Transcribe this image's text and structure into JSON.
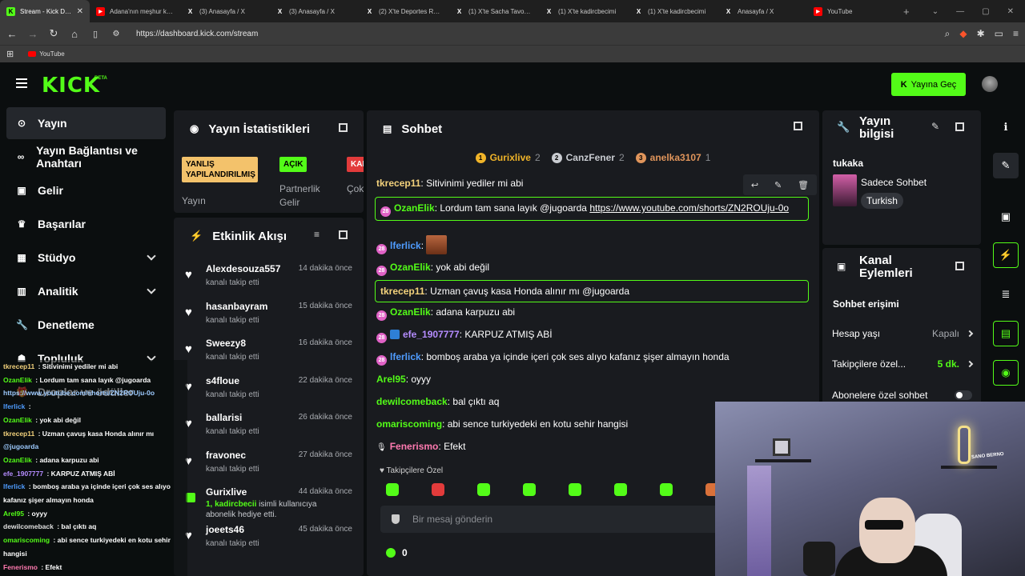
{
  "browser": {
    "tabs": [
      {
        "title": "Stream - Kick Dashboard",
        "icon": "kick-icon",
        "active": true
      },
      {
        "title": "Adana'nın meşhur karpuzu",
        "icon": "youtube-icon"
      },
      {
        "title": "(3) Anasayfa / X",
        "icon": "x-icon"
      },
      {
        "title": "(3) Anasayfa / X",
        "icon": "x-icon"
      },
      {
        "title": "(2) X'te Deportes Report",
        "icon": "x-icon"
      },
      {
        "title": "(1) X'te Sacha Tavolieri",
        "icon": "x-icon"
      },
      {
        "title": "(1) X'te kadircbecimi",
        "icon": "x-icon"
      },
      {
        "title": "(1) X'te kadircbecimi",
        "icon": "x-icon"
      },
      {
        "title": "Anasayfa / X",
        "icon": "x-icon"
      },
      {
        "title": "YouTube",
        "icon": "youtube-icon"
      }
    ],
    "new_tab": "+",
    "url": "https://dashboard.kick.com/stream",
    "bookmark": "YouTube"
  },
  "header": {
    "logo": "KICK",
    "beta": "BETA",
    "go_live": "Yayına Geç"
  },
  "sidebar": {
    "items": [
      {
        "label": "Yayın",
        "icon": "play-circle-icon",
        "active": true
      },
      {
        "label": "Yayın Bağlantısı ve Anahtarı",
        "icon": "link-icon"
      },
      {
        "label": "Gelir",
        "icon": "wallet-icon"
      },
      {
        "label": "Başarılar",
        "icon": "trophy-icon"
      },
      {
        "label": "Stüdyo",
        "icon": "studio-icon",
        "chevron": true
      },
      {
        "label": "Analitik",
        "icon": "chart-icon",
        "chevron": true
      },
      {
        "label": "Denetleme",
        "icon": "wrench-icon"
      },
      {
        "label": "Topluluk",
        "icon": "community-icon",
        "chevron": true
      },
      {
        "label": "Droplar ve ödüller",
        "icon": "gift-icon"
      }
    ]
  },
  "overlay_chat": [
    {
      "user": "tkrecep11",
      "text": " : Sitivinimi yediler mi abi",
      "color": "#f3d27c"
    },
    {
      "user": "OzanElik",
      "text": " : Lordum tam sana layık @jugoarda",
      "color": "#53fc18"
    },
    {
      "user": "",
      "text": "https://www.youtube.com/shorts/ZN2ROUju-0o",
      "color": "#9ecbff"
    },
    {
      "user": "lferlick",
      "text": " : ",
      "color": "#4f9cff"
    },
    {
      "user": "OzanElik",
      "text": " : yok abi değil",
      "color": "#53fc18"
    },
    {
      "user": "tkrecep11",
      "text": " : Uzman çavuş kasa Honda alınır mı",
      "color": "#f3d27c"
    },
    {
      "user": "",
      "text": "@jugoarda",
      "color": "#9ecbff"
    },
    {
      "user": "OzanElik",
      "text": " : adana karpuzu abi",
      "color": "#53fc18"
    },
    {
      "user": "efe_1907777",
      "text": " : KARPUZ ATMIŞ ABİ",
      "color": "#b58cff"
    },
    {
      "user": "lferlick",
      "text": " : bomboş araba ya içinde içeri çok ses alıyo",
      "color": "#4f9cff"
    },
    {
      "user": "",
      "text": "kafanız şişer almayın honda",
      "color": "#fff"
    },
    {
      "user": "Arel95",
      "text": " : oyyy",
      "color": "#53fc18"
    },
    {
      "user": "dewilcomeback",
      "text": " : bal çıktı aq",
      "color": "#e0e0e0"
    },
    {
      "user": "omariscoming",
      "text": " : abi sence turkiyedeki en kotu sehir",
      "color": "#53fc18"
    },
    {
      "user": "",
      "text": "hangisi",
      "color": "#fff"
    },
    {
      "user": "Fenerismo",
      "text": " : Efekt",
      "color": "#ff7ab0"
    }
  ],
  "stats": {
    "title": "Yayın İstatistikleri",
    "badges": [
      {
        "text": "YANLIŞ YAPILANDIRILMIŞ",
        "label": "Yayın",
        "bg": "#f3c26b"
      },
      {
        "text": "AÇIK",
        "label": "Partnerlik Gelir",
        "bg": "#53fc18"
      },
      {
        "text": "KAPALI",
        "label": "Çok Yayın",
        "bg": "#e23b3b"
      }
    ]
  },
  "activity": {
    "title": "Etkinlik Akışı",
    "items": [
      {
        "name": "Alexdesouza557",
        "time": "14 dakika önce",
        "desc": "kanalı takip etti",
        "type": "follow"
      },
      {
        "name": "hasanbayram",
        "time": "15 dakika önce",
        "desc": "kanalı takip etti",
        "type": "follow"
      },
      {
        "name": "Sweezy8",
        "time": "16 dakika önce",
        "desc": "kanalı takip etti",
        "type": "follow"
      },
      {
        "name": "s4floue",
        "time": "22 dakika önce",
        "desc": "kanalı takip etti",
        "type": "follow"
      },
      {
        "name": "ballarisi",
        "time": "26 dakika önce",
        "desc": "kanalı takip etti",
        "type": "follow"
      },
      {
        "name": "fravonec",
        "time": "27 dakika önce",
        "desc": "kanalı takip etti",
        "type": "follow"
      },
      {
        "name": "Gurixlive",
        "time": "44 dakika önce",
        "desc_count": "1,",
        "desc_user": "kadircbecii",
        "desc": "isimli kullanıcıya abonelik hediye etti.",
        "type": "gift"
      },
      {
        "name": "joeets46",
        "time": "45 dakika önce",
        "desc": "kanalı takip etti",
        "type": "follow"
      }
    ]
  },
  "chat": {
    "title": "Sohbet",
    "leaderboard": [
      {
        "rank": "1",
        "name": "Gurixlive",
        "count": "2",
        "color": "#f0b429"
      },
      {
        "rank": "2",
        "name": "CanzFener",
        "count": "2",
        "color": "#c9ccd1"
      },
      {
        "rank": "3",
        "name": "anelka3107",
        "count": "1",
        "color": "#e0955b"
      }
    ],
    "messages": [
      {
        "user": "tkrecep11",
        "text": "Sitivinimi yediler mi abi",
        "color": "#f3d27c"
      },
      {
        "user": "OzanElik",
        "text": "Lordum tam sana layık @jugoarda ",
        "link": "https://www.youtube.com/shorts/ZN2ROUju-0o",
        "color": "#53fc18"
      },
      {
        "user": "lferlick",
        "text": "",
        "color": "#4f9cff"
      },
      {
        "user": "OzanElik",
        "text": "yok abi değil",
        "color": "#53fc18"
      },
      {
        "user": "tkrecep11",
        "text": "Uzman çavuş kasa Honda alınır mı @jugoarda",
        "color": "#f3d27c"
      },
      {
        "user": "OzanElik",
        "text": "adana karpuzu abi",
        "color": "#53fc18"
      },
      {
        "user": "efe_1907777",
        "text": "KARPUZ ATMIŞ ABİ",
        "color": "#b58cff"
      },
      {
        "user": "lferlick",
        "text": "bomboş araba ya içinde içeri çok ses alıyo kafanız şişer almayın honda",
        "color": "#4f9cff"
      },
      {
        "user": "Arel95",
        "text": "oyyy",
        "color": "#53fc18"
      },
      {
        "user": "dewilcomeback",
        "text": "bal çıktı aq",
        "color": "#53fc18"
      },
      {
        "user": "omariscoming",
        "text": "abi sence turkiyedeki en kotu sehir hangisi",
        "color": "#53fc18"
      },
      {
        "user": "Fenerismo",
        "text": "Efekt",
        "color": "#ff7ab0"
      }
    ],
    "sub_badge": "28",
    "followers_only": "Takipçilere Özel",
    "placeholder": "Bir mesaj gönderin",
    "points": "0"
  },
  "stream_info": {
    "title": "Yayın bilgisi",
    "channel": "tukaka",
    "category": "Sadece Sohbet",
    "language": "Turkish"
  },
  "channel_actions": {
    "title": "Kanal Eylemleri",
    "section": "Sohbet erişimi",
    "rows": [
      {
        "label": "Hesap yaşı",
        "value": "Kapalı"
      },
      {
        "label": "Takipçilere özel...",
        "value": "5 dk."
      },
      {
        "label": "Abonelere özel sohbet",
        "value": ""
      }
    ]
  },
  "webcam": {
    "sign": "SANO BERNO"
  },
  "colors": {
    "accent": "#53fc18",
    "panel": "#191b1f",
    "bg": "#0b0e0f"
  }
}
